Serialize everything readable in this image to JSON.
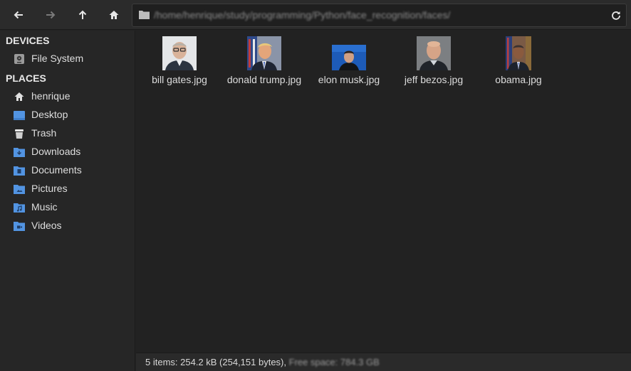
{
  "toolbar": {
    "back_icon": "arrow-left-icon",
    "forward_icon": "arrow-right-icon",
    "up_icon": "arrow-up-icon",
    "home_icon": "home-icon",
    "path": "/home/henrique/study/programming/Python/face_recognition/faces/",
    "reload_icon": "reload-icon"
  },
  "sidebar": {
    "devices_title": "DEVICES",
    "devices": [
      {
        "label": "File System",
        "icon": "drive-icon"
      }
    ],
    "places_title": "PLACES",
    "places": [
      {
        "label": "henrique",
        "icon": "home-icon"
      },
      {
        "label": "Desktop",
        "icon": "desktop-folder-icon"
      },
      {
        "label": "Trash",
        "icon": "trash-icon"
      },
      {
        "label": "Downloads",
        "icon": "downloads-folder-icon"
      },
      {
        "label": "Documents",
        "icon": "documents-folder-icon"
      },
      {
        "label": "Pictures",
        "icon": "pictures-folder-icon"
      },
      {
        "label": "Music",
        "icon": "music-folder-icon"
      },
      {
        "label": "Videos",
        "icon": "videos-folder-icon"
      }
    ]
  },
  "files": [
    {
      "name": "bill gates.jpg"
    },
    {
      "name": "donald trump.jpg"
    },
    {
      "name": "elon musk.jpg"
    },
    {
      "name": "jeff bezos.jpg"
    },
    {
      "name": "obama.jpg"
    }
  ],
  "status": {
    "summary": "5 items: 254.2 kB (254,151 bytes),",
    "free_space": "Free space: 784.3 GB"
  },
  "colors": {
    "folder_blue": "#5294e2",
    "background": "#222222",
    "sidebar": "#262626"
  }
}
